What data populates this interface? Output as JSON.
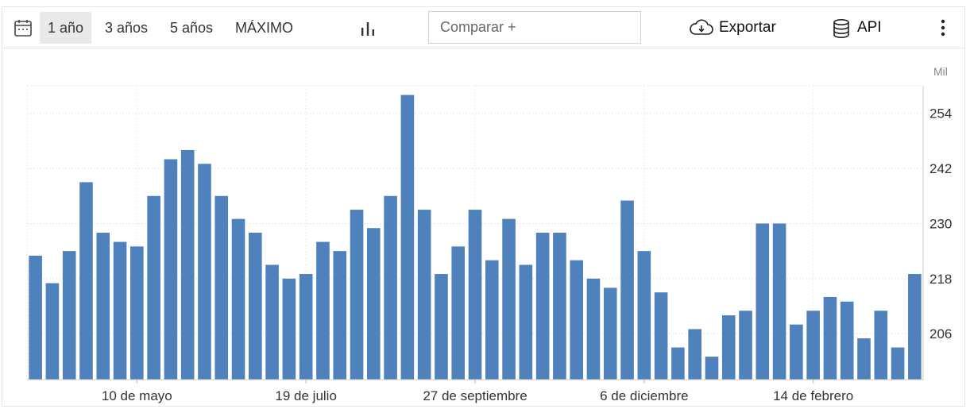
{
  "toolbar": {
    "periods": [
      "1 año",
      "3 años",
      "5 años",
      "MÁXIMO"
    ],
    "active_period": "1 año",
    "compare_placeholder": "Comparar +",
    "export_label": "Exportar",
    "api_label": "API",
    "icons": {
      "calendar": "calendar-icon",
      "chart_type": "bar-chart-icon",
      "export": "cloud-download-icon",
      "api": "database-icon",
      "more": "more-vertical-icon"
    }
  },
  "chart_data": {
    "type": "bar",
    "unit_label": "Mil",
    "bar_color": "#4f81bd",
    "ylim": [
      196,
      260
    ],
    "yticks": [
      206,
      218,
      230,
      242,
      254
    ],
    "x_tick_labels": [
      {
        "label": "10 de mayo",
        "index": 6
      },
      {
        "label": "19 de julio",
        "index": 16
      },
      {
        "label": "27 de septiembre",
        "index": 26
      },
      {
        "label": "6 de diciembre",
        "index": 36
      },
      {
        "label": "14 de febrero",
        "index": 46
      }
    ],
    "values": [
      223,
      217,
      224,
      239,
      228,
      226,
      225,
      236,
      244,
      246,
      243,
      236,
      231,
      228,
      221,
      218,
      219,
      226,
      224,
      233,
      229,
      236,
      258,
      233,
      219,
      225,
      233,
      222,
      231,
      221,
      228,
      228,
      222,
      218,
      216,
      235,
      224,
      215,
      203,
      207,
      201,
      210,
      211,
      230,
      230,
      208,
      211,
      214,
      213,
      205,
      211,
      203,
      219
    ],
    "grid": true,
    "y_axis_position": "right"
  }
}
